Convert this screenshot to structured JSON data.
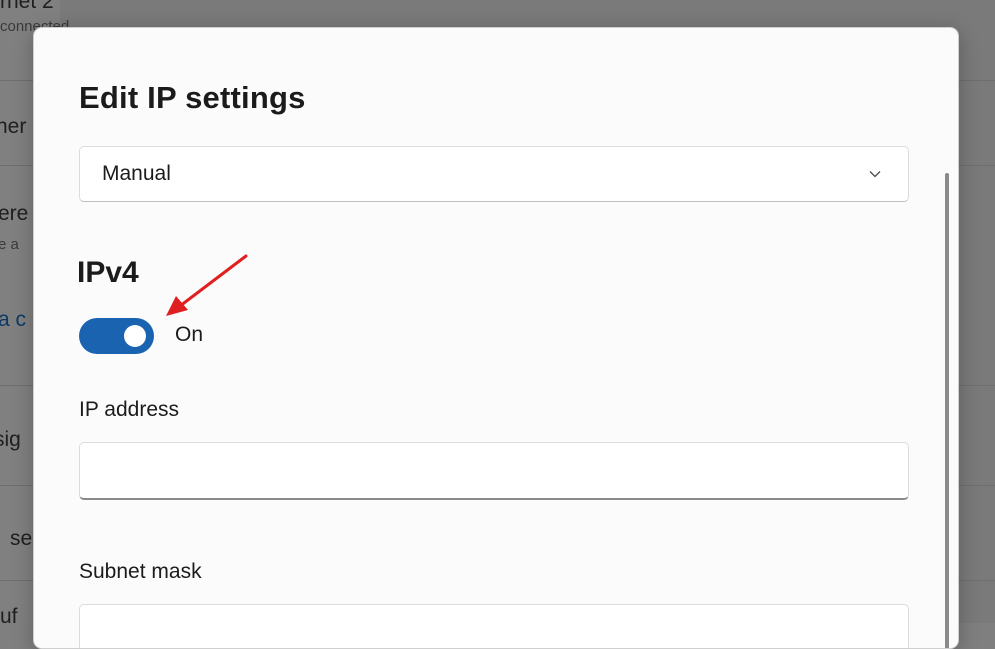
{
  "background": {
    "fragments": [
      {
        "text": "rnet 2",
        "size": "normal"
      },
      {
        "text": "connected",
        "size": "small"
      },
      {
        "text": "ner",
        "size": "normal"
      },
      {
        "text": "ere",
        "size": "normal"
      },
      {
        "text": "e a",
        "size": "small"
      },
      {
        "text": "a c",
        "size": "link"
      },
      {
        "text": "sig",
        "size": "normal"
      },
      {
        "text": "se",
        "size": "normal"
      },
      {
        "text": "uf",
        "size": "normal"
      }
    ]
  },
  "dialog": {
    "title": "Edit IP settings",
    "mode_select": {
      "value": "Manual",
      "icon": "chevron-down-icon"
    },
    "ipv4": {
      "heading": "IPv4",
      "toggle_state": "On",
      "toggle_on": true,
      "accent_color": "#1a63b0"
    },
    "fields": {
      "ip_address": {
        "label": "IP address",
        "value": ""
      },
      "subnet_mask": {
        "label": "Subnet mask",
        "value": ""
      }
    }
  },
  "annotation": {
    "arrow_color": "#e02020"
  }
}
